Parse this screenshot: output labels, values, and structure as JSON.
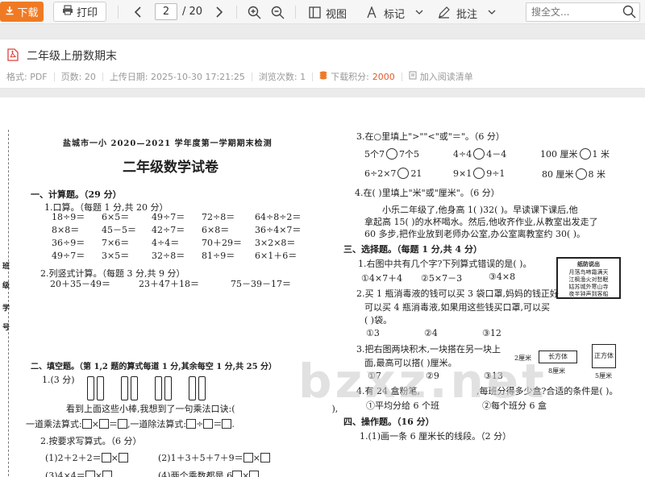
{
  "toolbar": {
    "download_label": "下载",
    "print_label": "打印",
    "current_page": "2",
    "total_pages": "/ 20",
    "view_label": "视图",
    "mark_label": "标记",
    "annotate_label": "批注",
    "search_placeholder": "搜全文...",
    "accent_color": "#f07a24"
  },
  "doc": {
    "title": "二年级上册数期末",
    "format": "格式: PDF",
    "pages": "页数: 20",
    "upload_date": "上传日期: 2025-10-30 17:21:25",
    "views": "浏览次数: 1",
    "points_label": "下载积分:",
    "points_value": "2000",
    "add_reading_list": "加入阅读清单"
  },
  "paper": {
    "school_header": "盐城市一小 2020—2021 学年度第一学期期末检测",
    "exam_title": "二年级数学试卷",
    "sec1": "一、计算题。（29 分）",
    "q1_1": "1.口算。（每题 1 分,共 20 分）",
    "calc_rows": [
      [
        "18÷9＝",
        "6×5＝",
        "49÷7＝",
        "72÷8＝",
        "64÷8÷2＝"
      ],
      [
        "8×8＝",
        "45－5＝",
        "42÷7＝",
        "6×8＝",
        "36÷4×7＝"
      ],
      [
        "36÷9＝",
        "7×6＝",
        "4÷4＝",
        "70＋29＝",
        "3×2×8＝"
      ],
      [
        "49÷7＝",
        "3×5＝",
        "32÷8＝",
        "81÷9＝",
        "6×1＋6＝"
      ]
    ],
    "q1_2": "2.列竖式计算。（每题 3 分,共 9 分）",
    "vertical": [
      "20＋35－49＝",
      "23＋47＋18＝",
      "75－39－17＝"
    ],
    "sec2": "二、填空题。（第 1,2 题的算式每道 1 分,其余每空 1 分,共 25 分）",
    "q2_1": "1.(3 分)",
    "q2_1_text": "看到上面这些小棒,我想到了一句乘法口诀:(",
    "q2_1_close": "),",
    "q2_1_mul": "一道乘法算式:",
    "q2_1_div": ",一道除法算式:",
    "q2_2": "2.按要求写算式。（6 分）",
    "q2_2_a": "(1)2＋2＋2＝",
    "q2_2_b": "(2)1＋3＋5＋7＋9＝",
    "q2_2_c": "(3)4×4＝",
    "q2_2_d": "(4)两个乘数都是 6",
    "q3": "3.在○里填上\">\"\"<\"或\"＝\"。（6 分）",
    "cmp_rows": [
      [
        "5个7",
        "7个5",
        "4÷4",
        "4－4",
        "100 厘米",
        "1 米"
      ],
      [
        "6÷2×7",
        "21",
        "9×1",
        "9÷1",
        "80 厘米",
        "8 米"
      ]
    ],
    "q4": "4.在(    )里填上\"米\"或\"厘米\"。（6 分）",
    "q4_l1": "小乐二年级了,他身高 1(        )32(        )。早读课下课后,他",
    "q4_l2": "拿起高 15(        )的水杯喝水。然后,他收齐作业,从教室出发走了",
    "q4_l3": "60 多步,把作业放到老师办公室,办公室离教室约 30(        )。",
    "sec3": "三、选择题。（每题 1 分,共 4 分）",
    "s1": "1.右图中共有几个字?下列算式错误的是(    )。",
    "s1_opts": [
      "①4×7＋4",
      "②5×7－3",
      "③4×8"
    ],
    "notice_lines": [
      "纸防说出",
      "月落鸟啼霜满天",
      "江枫渔火对愁眠",
      "姑苏城外寒山寺",
      "夜半钟声到客船"
    ],
    "s2_l1": "2.买 1 瓶消毒液的钱可以买 3 袋口罩,妈妈的钱正好",
    "s2_l2": "可以买 4 瓶消毒液,如果用这些钱买口罩,可以买",
    "s2_l3": "(    )袋。",
    "s2_opts": [
      "①3",
      "②4",
      "③12"
    ],
    "s3_l1": "3.把右图两块积木,一块搭在另一块上",
    "s3_l2": "面,最高可以搭(    )厘米。",
    "s3_opts": [
      "①7",
      "②9",
      "③13"
    ],
    "cuboid_label": "长方体",
    "cube_label": "正方体",
    "dim_2": "2厘米",
    "dim_8": "8厘米",
    "dim_5": "5厘米",
    "s4_l1": "4.有 24 盒粉笔,",
    "s4_l2": ",每班分得多少盒?合适的条件是(    )。",
    "s4_opts": [
      "①平均分给 6 个班",
      "②每个班分 6 盒"
    ],
    "sec4": "四、操作题。（16 分）",
    "op1": "1.(1)画一条 6 厘米长的线段。（2 分）",
    "side_chars": [
      "班",
      "级",
      "学",
      "号"
    ],
    "watermark": "bzxz.net"
  }
}
